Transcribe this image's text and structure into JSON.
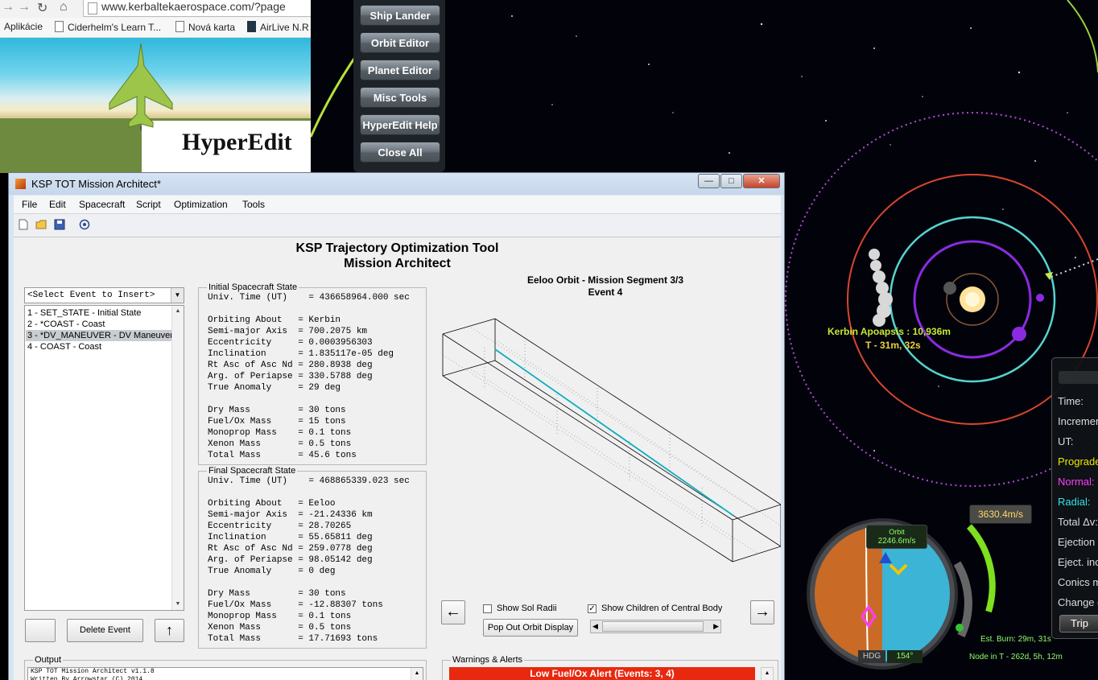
{
  "browser": {
    "url": "www.kerbaltekaerospace.com/?page",
    "bookmarks": [
      "Aplikácie",
      "Ciderhelm's Learn T...",
      "Nová karta",
      "AirLive N.R"
    ],
    "page_heading": "HyperEdit"
  },
  "hyperedit_menu": {
    "buttons": [
      "Ship Lander",
      "Orbit Editor",
      "Planet Editor",
      "Misc Tools",
      "HyperEdit Help",
      "Close All"
    ]
  },
  "window": {
    "title": "KSP TOT Mission Architect*",
    "controls": [
      "—",
      "□",
      "✕"
    ],
    "menu": [
      "File",
      "Edit",
      "Spacecraft",
      "Script",
      "Optimization",
      "Tools"
    ],
    "app_title_line1": "KSP Trajectory Optimization Tool",
    "app_title_line2": "Mission Architect",
    "event_select_value": "<Select Event to Insert>",
    "events": [
      "1 - SET_STATE - Initial State",
      "2 - *COAST - Coast",
      "3 - *DV_MANEUVER - DV Maneuver",
      "4 - COAST - Coast"
    ],
    "selected_event_index": 2,
    "buttons": {
      "delete_event": "Delete Event",
      "move_up": "↑",
      "prev": "←",
      "next": "→",
      "pop_out": "Pop Out Orbit Display"
    },
    "initial_state": {
      "legend": "Initial Spacecraft State",
      "univ_time": "Univ. Time (UT)    = 436658964.000 sec",
      "orbit": "Orbiting About   = Kerbin\nSemi-major Axis  = 700.2075 km\nEccentricity     = 0.0003956303\nInclination      = 1.835117e-05 deg\nRt Asc of Asc Nd = 280.8938 deg\nArg. of Periapse = 330.5788 deg\nTrue Anomaly     = 29 deg",
      "mass": "Dry Mass         = 30 tons\nFuel/Ox Mass     = 15 tons\nMonoprop Mass    = 0.1 tons\nXenon Mass       = 0.5 tons\nTotal Mass       = 45.6 tons"
    },
    "final_state": {
      "legend": "Final Spacecraft State",
      "univ_time": "Univ. Time (UT)    = 468865339.023 sec",
      "orbit": "Orbiting About   = Eeloo\nSemi-major Axis  = -21.24336 km\nEccentricity     = 28.70265\nInclination      = 55.65811 deg\nRt Asc of Asc Nd = 259.0778 deg\nArg. of Periapse = 98.05142 deg\nTrue Anomaly     = 0 deg",
      "mass": "Dry Mass         = 30 tons\nFuel/Ox Mass     = -12.88307 tons\nMonoprop Mass    = 0.1 tons\nXenon Mass       = 0.5 tons\nTotal Mass       = 17.71693 tons"
    },
    "plot_title_line1": "Eeloo Orbit - Mission Segment 3/3",
    "plot_title_line2": "Event 4",
    "show_sol_radii": "Show Sol Radii",
    "show_sol_radii_checked": false,
    "show_children": "Show Children of Central Body",
    "show_children_checked": true,
    "output_legend": "Output",
    "output_text": "KSP TOT Mission Architect v1.1.8\nWritten By Arrowstar (C) 2014\n**********************************************************",
    "warnings_legend": "Warnings & Alerts",
    "alert_text": "Low Fuel/Ox Alert (Events: 3, 4)"
  },
  "ksp": {
    "map_label_1": "Kerbin Apoapsis : 10,936m",
    "map_label_2": "T - 31m, 32s",
    "maneuver_labels": [
      "Time:",
      "Increment",
      "UT:",
      "Prograde",
      "Normal:",
      "Radial:",
      "Total Δv:",
      "Ejection",
      "Eject. inc",
      "Conics m",
      "Change c"
    ],
    "trip_button": "Trip",
    "dv_readout": "3630.4m/s",
    "orbit_mode": "Orbit",
    "orbit_speed": "2246.6m/s",
    "hdg_label": "HDG",
    "hdg_value": "154°",
    "est_burn": "Est. Burn: 29m, 31s",
    "node_in": "Node in T - 262d, 5h, 12m",
    "colors": {
      "prograde": "#e8e800",
      "normal": "#ff3cff",
      "radial": "#35e3e8",
      "alert": "#e8290f"
    }
  }
}
